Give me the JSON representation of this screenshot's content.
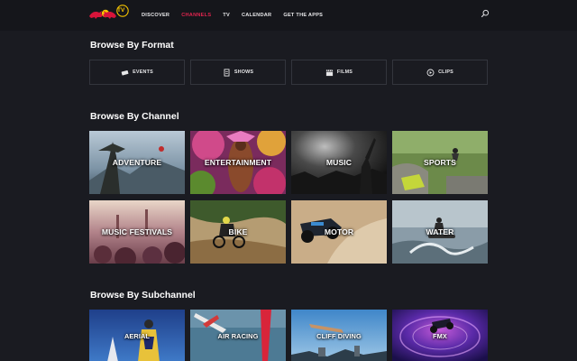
{
  "brand": {
    "logo_text": "TV",
    "logo_name": "Red Bull TV"
  },
  "nav": {
    "items": [
      {
        "label": "DISCOVER",
        "active": false
      },
      {
        "label": "CHANNELS",
        "active": true
      },
      {
        "label": "TV",
        "active": false
      },
      {
        "label": "CALENDAR",
        "active": false
      },
      {
        "label": "GET THE APPS",
        "active": false
      }
    ],
    "search_icon": "search-icon",
    "active_color": "#e0244e"
  },
  "sections": {
    "format": {
      "title": "Browse By Format",
      "items": [
        {
          "label": "EVENTS",
          "icon": "ticket-icon"
        },
        {
          "label": "SHOWS",
          "icon": "document-icon"
        },
        {
          "label": "FILMS",
          "icon": "clapperboard-icon"
        },
        {
          "label": "CLIPS",
          "icon": "play-circle-icon"
        }
      ]
    },
    "channel": {
      "title": "Browse By Channel",
      "items": [
        {
          "label": "ADVENTURE"
        },
        {
          "label": "ENTERTAINMENT"
        },
        {
          "label": "MUSIC"
        },
        {
          "label": "SPORTS"
        },
        {
          "label": "MUSIC FESTIVALS"
        },
        {
          "label": "BIKE"
        },
        {
          "label": "MOTOR"
        },
        {
          "label": "WATER"
        }
      ]
    },
    "subchannel": {
      "title": "Browse By Subchannel",
      "items": [
        {
          "label": "AERIAL"
        },
        {
          "label": "AIR RACING"
        },
        {
          "label": "CLIFF DIVING"
        },
        {
          "label": "FMX"
        }
      ]
    }
  },
  "colors": {
    "background": "#1a1b21",
    "topbar": "#15161b",
    "border": "#33353d"
  }
}
